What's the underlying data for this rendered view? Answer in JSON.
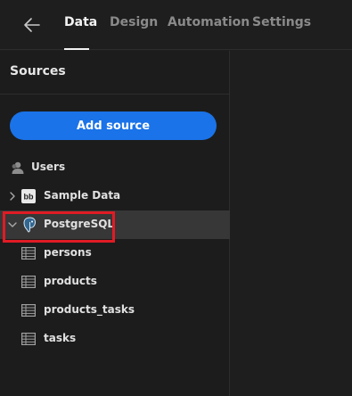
{
  "nav": {
    "back_icon": "back-arrow-icon",
    "tabs": [
      {
        "label": "Data",
        "active": true
      },
      {
        "label": "Design",
        "active": false
      },
      {
        "label": "Automation",
        "active": false
      },
      {
        "label": "Settings",
        "active": false
      }
    ]
  },
  "sidebar": {
    "title": "Sources",
    "add_button": "Add source",
    "items": [
      {
        "label": "Users",
        "icon": "user-icon"
      },
      {
        "label": "Sample Data",
        "icon": "budibase-icon",
        "expanded": false
      },
      {
        "label": "PostgreSQL",
        "icon": "postgresql-icon",
        "expanded": true,
        "selected": true
      }
    ],
    "tables": [
      {
        "label": "persons",
        "icon": "table-icon"
      },
      {
        "label": "products",
        "icon": "table-icon"
      },
      {
        "label": "products_tasks",
        "icon": "table-icon"
      },
      {
        "label": "tasks",
        "icon": "table-icon"
      }
    ]
  },
  "colors": {
    "accent": "#1a73e8",
    "highlight": "#e01b24",
    "background": "#1e1e1e",
    "selected_row": "#373737"
  }
}
